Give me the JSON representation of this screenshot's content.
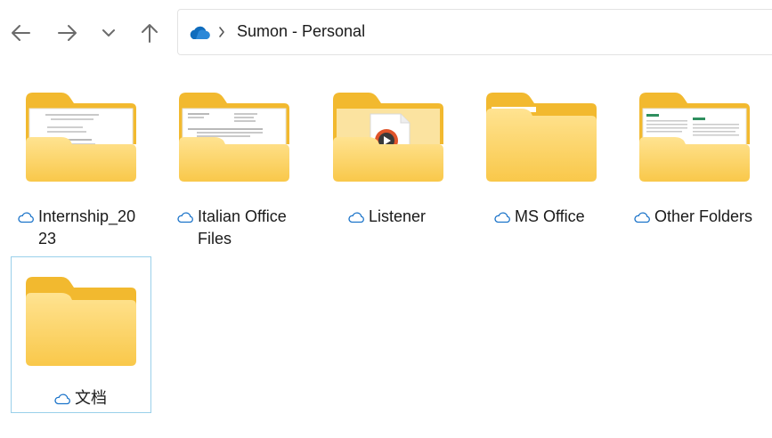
{
  "toolbar": {
    "back_icon": "arrow-left-icon",
    "forward_icon": "arrow-right-icon",
    "recent_icon": "chevron-down-icon",
    "up_icon": "arrow-up-icon"
  },
  "address": {
    "location_icon": "onedrive-cloud-icon",
    "separator": "›",
    "path": "Sumon - Personal"
  },
  "items": [
    {
      "label": "Internship_2023",
      "status_icon": "cloud-outline-icon",
      "preview": "document-preview"
    },
    {
      "label": "Italian Office Files",
      "status_icon": "cloud-outline-icon",
      "preview": "document-preview"
    },
    {
      "label": "Listener",
      "status_icon": "cloud-outline-icon",
      "preview": "media-file-preview"
    },
    {
      "label": "MS Office",
      "status_icon": "cloud-outline-icon",
      "preview": "empty-folder"
    },
    {
      "label": "Other Folders",
      "status_icon": "cloud-outline-icon",
      "preview": "document-preview"
    },
    {
      "label": "文档",
      "status_icon": "cloud-outline-icon",
      "preview": "empty-folder",
      "selected": true
    }
  ],
  "colors": {
    "folder_back": "#f2b92f",
    "folder_front_top": "#ffe08a",
    "folder_front_bottom": "#f9c84a",
    "cloud_stroke": "#1a73c9",
    "onedrive": "#0f6cbd",
    "selection_border": "#9ad0ea"
  }
}
